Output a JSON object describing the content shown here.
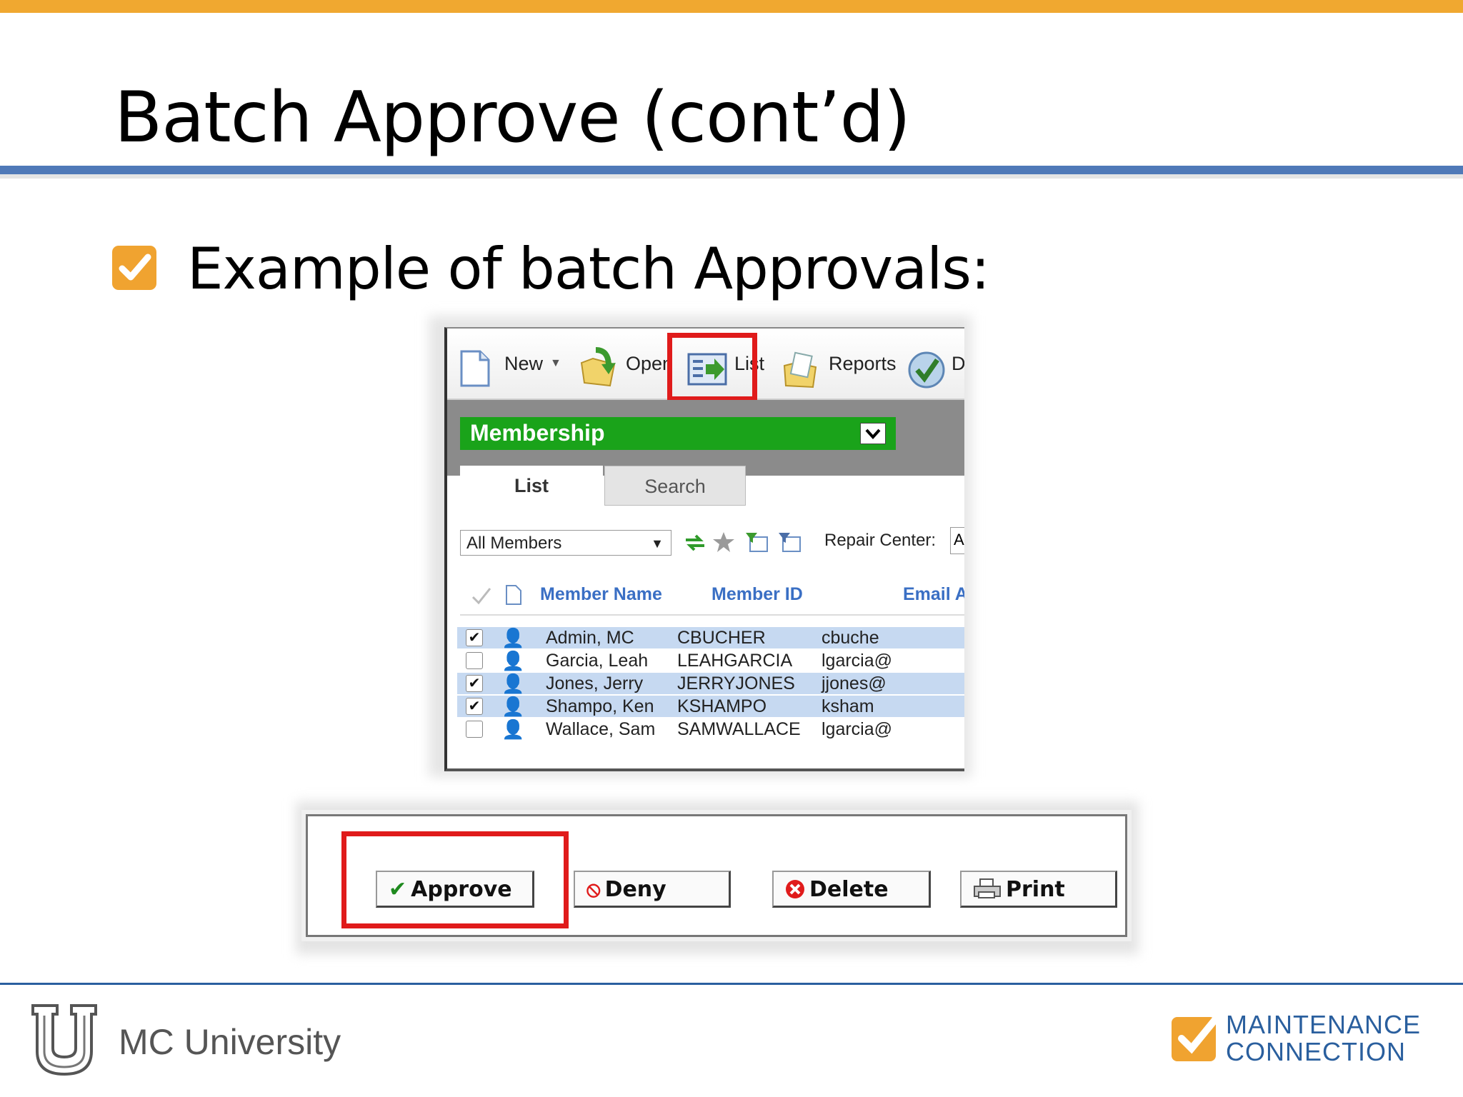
{
  "slide": {
    "title": "Batch Approve (cont’d)",
    "bullet": "Example of batch Approvals:"
  },
  "toolbar": {
    "new_label": "New",
    "open_label": "Open",
    "list_label": "List",
    "reports_label": "Reports",
    "d_label": "D"
  },
  "module": {
    "label": "Membership"
  },
  "tabs": [
    {
      "label": "List"
    },
    {
      "label": "Search"
    }
  ],
  "filter": {
    "selected": "All Members",
    "repair_center_label": "Repair Center:",
    "repair_center_value": "A"
  },
  "table": {
    "columns": [
      "Member Name",
      "Member ID",
      "Email A"
    ],
    "rows": [
      {
        "name": "Admin, MC",
        "id": "CBUCHER",
        "email": "cbuche",
        "checked": true
      },
      {
        "name": "Garcia, Leah",
        "id": "LEAHGARCIA",
        "email": "lgarcia@",
        "checked": false
      },
      {
        "name": "Jones, Jerry",
        "id": "JERRYJONES",
        "email": "jjones@",
        "checked": true
      },
      {
        "name": "Shampo, Ken",
        "id": "KSHAMPO",
        "email": "ksham",
        "checked": true
      },
      {
        "name": "Wallace, Sam",
        "id": "SAMWALLACE",
        "email": "lgarcia@",
        "checked": false
      }
    ]
  },
  "actions": {
    "approve": "Approve",
    "deny": "Deny",
    "delete": "Delete",
    "print": "Print"
  },
  "footer": {
    "university": "MC University",
    "brand_line1": "MAINTENANCE",
    "brand_line2": "CONNECTION"
  },
  "colors": {
    "accent_orange": "#f0a830",
    "title_rule_blue": "#4f79b8",
    "highlight_red": "#e01b1b",
    "module_green": "#1aa31a",
    "row_selected": "#c6d9f1"
  }
}
